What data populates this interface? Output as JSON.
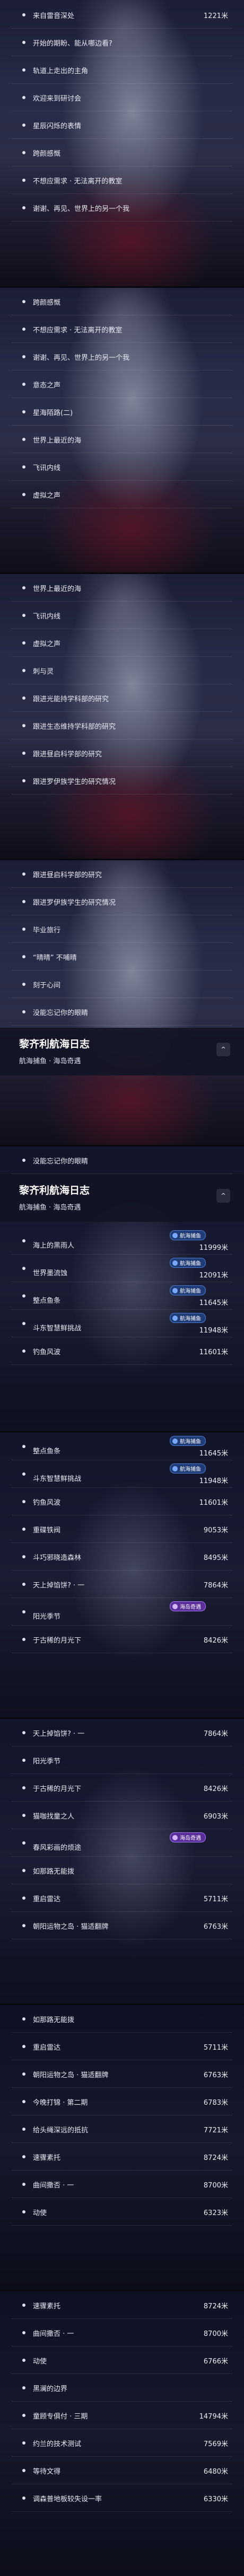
{
  "panel1": {
    "rows": [
      {
        "label": "来自雷音深处",
        "distance": "1221米"
      },
      {
        "label": "开始的期盼、能从哪边看?"
      },
      {
        "label": "轨道上走出的主角"
      },
      {
        "label": "欢迎来到研讨会"
      },
      {
        "label": "星辰闪烁的表情"
      },
      {
        "label": "跨颜感慨"
      },
      {
        "label": "不想应需求 · 无法离开的教室"
      },
      {
        "label": "谢谢、再见、世界上的另一个我"
      }
    ]
  },
  "panel2": {
    "rows": [
      {
        "label": "跨颜感慨"
      },
      {
        "label": "不想应需求 · 无法离开的教室"
      },
      {
        "label": "谢谢、再见、世界上的另一个我"
      },
      {
        "label": "意态之声"
      },
      {
        "label": "星海陌路(二)"
      },
      {
        "label": "世界上最近的海"
      },
      {
        "label": "飞讯内线"
      },
      {
        "label": "虚拟之声"
      }
    ]
  },
  "panel3": {
    "rows": [
      {
        "label": "世界上最近的海"
      },
      {
        "label": "飞讯内线"
      },
      {
        "label": "虚拟之声"
      },
      {
        "label": "刺与灵"
      },
      {
        "label": "跟进光能持学科部的研究"
      },
      {
        "label": "跟进生态维持学科部的研究"
      },
      {
        "label": "跟进昼启科学部的研究"
      },
      {
        "label": "跟进罗伊族学生的研究情况"
      }
    ]
  },
  "panel4": {
    "rows": [
      {
        "label": "跟进昼启科学部的研究"
      },
      {
        "label": "跟进罗伊族学生的研究情况"
      },
      {
        "label": "毕业旅行"
      },
      {
        "label": "“晴晴” 不哺晴"
      },
      {
        "label": "刻于心间"
      },
      {
        "label": "没能忘记你的眼睛"
      }
    ],
    "header": {
      "title": "黎齐利航海日志",
      "subtitle": "航海捕鱼 · 海岛奇遇",
      "collapse": "^"
    }
  },
  "panel5": {
    "row_top": {
      "label": "没能忘记你的眼睛"
    },
    "header": {
      "title": "黎齐利航海日志",
      "subtitle": "航海捕鱼 · 海岛奇遇",
      "collapse": "^"
    },
    "rows": [
      {
        "label": "海上的黑雨人",
        "distance": "11999米",
        "badge": "航海捕鱼"
      },
      {
        "label": "世界墨流蚀",
        "distance": "12091米",
        "badge": "航海捕鱼"
      },
      {
        "label": "整点鱼条",
        "distance": "11645米",
        "badge": "航海捕鱼"
      },
      {
        "label": "斗东智慧鲜挑战",
        "distance": "11948米",
        "badge": "航海捕鱼"
      },
      {
        "label": "钓鱼风波",
        "distance": "11601米"
      }
    ]
  },
  "panel6": {
    "rows": [
      {
        "label": "整点鱼条",
        "distance": "11645米",
        "badge": "航海捕鱼"
      },
      {
        "label": "斗东智慧鲜挑战",
        "distance": "11948米",
        "badge": "航海捕鱼"
      },
      {
        "label": "钓鱼风波",
        "distance": "11601米"
      },
      {
        "label": "重碟铁阀",
        "distance": "9053米"
      },
      {
        "label": "斗巧邪晓造森林",
        "distance": "8495米"
      },
      {
        "label": "天上掉馅饼? · 一",
        "distance": "7864米"
      },
      {
        "label": "阳光季节",
        "distance": "",
        "badge": "海岛奇遇",
        "purple": true
      },
      {
        "label": "于古稀的月光下",
        "distance": "8426米"
      }
    ]
  },
  "panel7": {
    "rows": [
      {
        "label": "天上掉馅饼? · 一",
        "distance": "7864米"
      },
      {
        "label": "阳光季节",
        "distance": ""
      },
      {
        "label": "于古稀的月光下",
        "distance": "8426米"
      },
      {
        "label": "猫咖找童之人",
        "distance": "6903米"
      },
      {
        "label": "春风彩画的烦途",
        "distance": "",
        "badge": "海岛奇遇",
        "purple": true
      },
      {
        "label": "如那路无能拨",
        "distance": ""
      },
      {
        "label": "重启雷达",
        "distance": "5711米"
      },
      {
        "label": "朝阳运物之岛 · 猫适翻牌",
        "distance": "6763米"
      }
    ]
  },
  "panel8": {
    "rows": [
      {
        "label": "如那路无能拨",
        "distance": ""
      },
      {
        "label": "重启雷达",
        "distance": "5711米"
      },
      {
        "label": "朝阳运物之岛 · 猫适翻牌",
        "distance": "6763米"
      },
      {
        "label": "今晚打锦 · 第二期",
        "distance": "6783米"
      },
      {
        "label": "给头绳深远的抵抗",
        "distance": "7721米"
      },
      {
        "label": "速骤素托",
        "distance": "8724米"
      },
      {
        "label": "曲间撒否 · 一",
        "distance": "8700米"
      },
      {
        "label": "动使",
        "distance": "6323米"
      }
    ]
  },
  "panel9": {
    "rows": [
      {
        "label": "速骤素托",
        "distance": "8724米"
      },
      {
        "label": "曲间撒否 · 一",
        "distance": "8700米"
      },
      {
        "label": "动使",
        "distance": "6766米"
      },
      {
        "label": "黑澜的边界",
        "distance": ""
      },
      {
        "label": "童顾专俱付 · 三期",
        "distance": "14794米"
      },
      {
        "label": "约兰的技术测试",
        "distance": "7569米"
      },
      {
        "label": "等待文得",
        "distance": "6480米"
      },
      {
        "label": "调森普地板较失设一率",
        "distance": "6330米"
      }
    ]
  }
}
